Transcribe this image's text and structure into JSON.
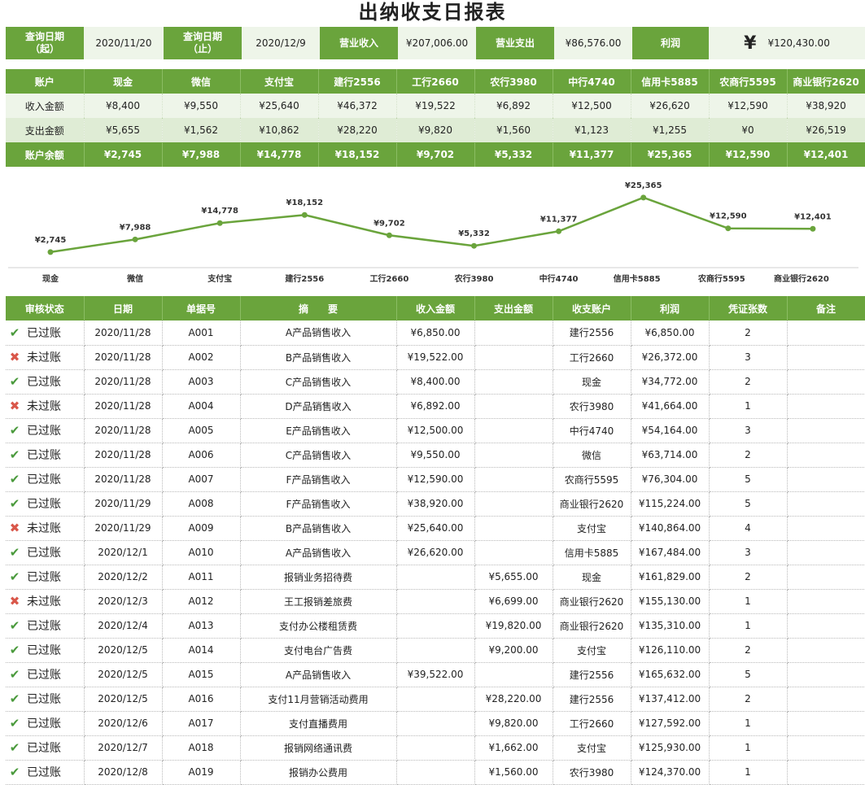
{
  "title": "出纳收支日报表",
  "summary": {
    "start_label": "查询日期\n（起）",
    "start_label_l1": "查询日期",
    "start_label_l2": "（起）",
    "start_value": "2020/11/20",
    "end_label_l1": "查询日期",
    "end_label_l2": "（止）",
    "end_value": "2020/12/9",
    "income_label": "营业收入",
    "income_value": "¥207,006.00",
    "expense_label": "营业支出",
    "expense_value": "¥86,576.00",
    "profit_label": "利润",
    "profit_symbol": "¥",
    "profit_value": "¥120,430.00"
  },
  "accounts": {
    "header_label": "账户",
    "names": [
      "现金",
      "微信",
      "支付宝",
      "建行2556",
      "工行2660",
      "农行3980",
      "中行4740",
      "信用卡5885",
      "农商行5595",
      "商业银行2620"
    ],
    "income_label": "收入金额",
    "income": [
      "¥8,400",
      "¥9,550",
      "¥25,640",
      "¥46,372",
      "¥19,522",
      "¥6,892",
      "¥12,500",
      "¥26,620",
      "¥12,590",
      "¥38,920"
    ],
    "expense_label": "支出金额",
    "expense": [
      "¥5,655",
      "¥1,562",
      "¥10,862",
      "¥28,220",
      "¥9,820",
      "¥1,560",
      "¥1,123",
      "¥1,255",
      "¥0",
      "¥26,519"
    ],
    "balance_label": "账户余额",
    "balance": [
      "¥2,745",
      "¥7,988",
      "¥14,778",
      "¥18,152",
      "¥9,702",
      "¥5,332",
      "¥11,377",
      "¥25,365",
      "¥12,590",
      "¥12,401"
    ]
  },
  "chart_data": {
    "type": "line",
    "categories": [
      "现金",
      "微信",
      "支付宝",
      "建行2556",
      "工行2660",
      "农行3980",
      "中行4740",
      "信用卡5885",
      "农商行5595",
      "商业银行2620"
    ],
    "values": [
      2745,
      7988,
      14778,
      18152,
      9702,
      5332,
      11377,
      25365,
      12590,
      12401
    ],
    "data_labels": [
      "¥2,745",
      "¥7,988",
      "¥14,778",
      "¥18,152",
      "¥9,702",
      "¥5,332",
      "¥11,377",
      "¥25,365",
      "¥12,590",
      "¥12,401"
    ],
    "title": "",
    "xlabel": "",
    "ylabel": "",
    "grid": false,
    "legend": "none",
    "line_color": "#6aa43c"
  },
  "detail": {
    "headers": [
      "审核状态",
      "日期",
      "单据号",
      "摘　　要",
      "收入金额",
      "支出金额",
      "收支账户",
      "利润",
      "凭证张数",
      "备注"
    ],
    "rows": [
      {
        "ok": true,
        "status": "已过账",
        "date": "2020/11/28",
        "doc": "A001",
        "memo": "A产品销售收入",
        "income": "¥6,850.00",
        "expense": "",
        "account": "建行2556",
        "profit": "¥6,850.00",
        "vouchers": "2",
        "note": ""
      },
      {
        "ok": false,
        "status": "未过账",
        "date": "2020/11/28",
        "doc": "A002",
        "memo": "B产品销售收入",
        "income": "¥19,522.00",
        "expense": "",
        "account": "工行2660",
        "profit": "¥26,372.00",
        "vouchers": "3",
        "note": ""
      },
      {
        "ok": true,
        "status": "已过账",
        "date": "2020/11/28",
        "doc": "A003",
        "memo": "C产品销售收入",
        "income": "¥8,400.00",
        "expense": "",
        "account": "现金",
        "profit": "¥34,772.00",
        "vouchers": "2",
        "note": ""
      },
      {
        "ok": false,
        "status": "未过账",
        "date": "2020/11/28",
        "doc": "A004",
        "memo": "D产品销售收入",
        "income": "¥6,892.00",
        "expense": "",
        "account": "农行3980",
        "profit": "¥41,664.00",
        "vouchers": "1",
        "note": ""
      },
      {
        "ok": true,
        "status": "已过账",
        "date": "2020/11/28",
        "doc": "A005",
        "memo": "E产品销售收入",
        "income": "¥12,500.00",
        "expense": "",
        "account": "中行4740",
        "profit": "¥54,164.00",
        "vouchers": "3",
        "note": ""
      },
      {
        "ok": true,
        "status": "已过账",
        "date": "2020/11/28",
        "doc": "A006",
        "memo": "C产品销售收入",
        "income": "¥9,550.00",
        "expense": "",
        "account": "微信",
        "profit": "¥63,714.00",
        "vouchers": "2",
        "note": ""
      },
      {
        "ok": true,
        "status": "已过账",
        "date": "2020/11/28",
        "doc": "A007",
        "memo": "F产品销售收入",
        "income": "¥12,590.00",
        "expense": "",
        "account": "农商行5595",
        "profit": "¥76,304.00",
        "vouchers": "5",
        "note": ""
      },
      {
        "ok": true,
        "status": "已过账",
        "date": "2020/11/29",
        "doc": "A008",
        "memo": "F产品销售收入",
        "income": "¥38,920.00",
        "expense": "",
        "account": "商业银行2620",
        "profit": "¥115,224.00",
        "vouchers": "5",
        "note": ""
      },
      {
        "ok": false,
        "status": "未过账",
        "date": "2020/11/29",
        "doc": "A009",
        "memo": "B产品销售收入",
        "income": "¥25,640.00",
        "expense": "",
        "account": "支付宝",
        "profit": "¥140,864.00",
        "vouchers": "4",
        "note": ""
      },
      {
        "ok": true,
        "status": "已过账",
        "date": "2020/12/1",
        "doc": "A010",
        "memo": "A产品销售收入",
        "income": "¥26,620.00",
        "expense": "",
        "account": "信用卡5885",
        "profit": "¥167,484.00",
        "vouchers": "3",
        "note": ""
      },
      {
        "ok": true,
        "status": "已过账",
        "date": "2020/12/2",
        "doc": "A011",
        "memo": "报销业务招待费",
        "income": "",
        "expense": "¥5,655.00",
        "account": "现金",
        "profit": "¥161,829.00",
        "vouchers": "2",
        "note": ""
      },
      {
        "ok": false,
        "status": "未过账",
        "date": "2020/12/3",
        "doc": "A012",
        "memo": "王工报销差旅费",
        "income": "",
        "expense": "¥6,699.00",
        "account": "商业银行2620",
        "profit": "¥155,130.00",
        "vouchers": "1",
        "note": ""
      },
      {
        "ok": true,
        "status": "已过账",
        "date": "2020/12/4",
        "doc": "A013",
        "memo": "支付办公楼租赁费",
        "income": "",
        "expense": "¥19,820.00",
        "account": "商业银行2620",
        "profit": "¥135,310.00",
        "vouchers": "1",
        "note": ""
      },
      {
        "ok": true,
        "status": "已过账",
        "date": "2020/12/5",
        "doc": "A014",
        "memo": "支付电台广告费",
        "income": "",
        "expense": "¥9,200.00",
        "account": "支付宝",
        "profit": "¥126,110.00",
        "vouchers": "2",
        "note": ""
      },
      {
        "ok": true,
        "status": "已过账",
        "date": "2020/12/5",
        "doc": "A015",
        "memo": "A产品销售收入",
        "income": "¥39,522.00",
        "expense": "",
        "account": "建行2556",
        "profit": "¥165,632.00",
        "vouchers": "5",
        "note": ""
      },
      {
        "ok": true,
        "status": "已过账",
        "date": "2020/12/5",
        "doc": "A016",
        "memo": "支付11月营销活动费用",
        "income": "",
        "expense": "¥28,220.00",
        "account": "建行2556",
        "profit": "¥137,412.00",
        "vouchers": "2",
        "note": ""
      },
      {
        "ok": true,
        "status": "已过账",
        "date": "2020/12/6",
        "doc": "A017",
        "memo": "支付直播费用",
        "income": "",
        "expense": "¥9,820.00",
        "account": "工行2660",
        "profit": "¥127,592.00",
        "vouchers": "1",
        "note": ""
      },
      {
        "ok": true,
        "status": "已过账",
        "date": "2020/12/7",
        "doc": "A018",
        "memo": "报销网络通讯费",
        "income": "",
        "expense": "¥1,662.00",
        "account": "支付宝",
        "profit": "¥125,930.00",
        "vouchers": "1",
        "note": ""
      },
      {
        "ok": true,
        "status": "已过账",
        "date": "2020/12/8",
        "doc": "A019",
        "memo": "报销办公费用",
        "income": "",
        "expense": "¥1,560.00",
        "account": "农行3980",
        "profit": "¥124,370.00",
        "vouchers": "1",
        "note": ""
      }
    ]
  }
}
